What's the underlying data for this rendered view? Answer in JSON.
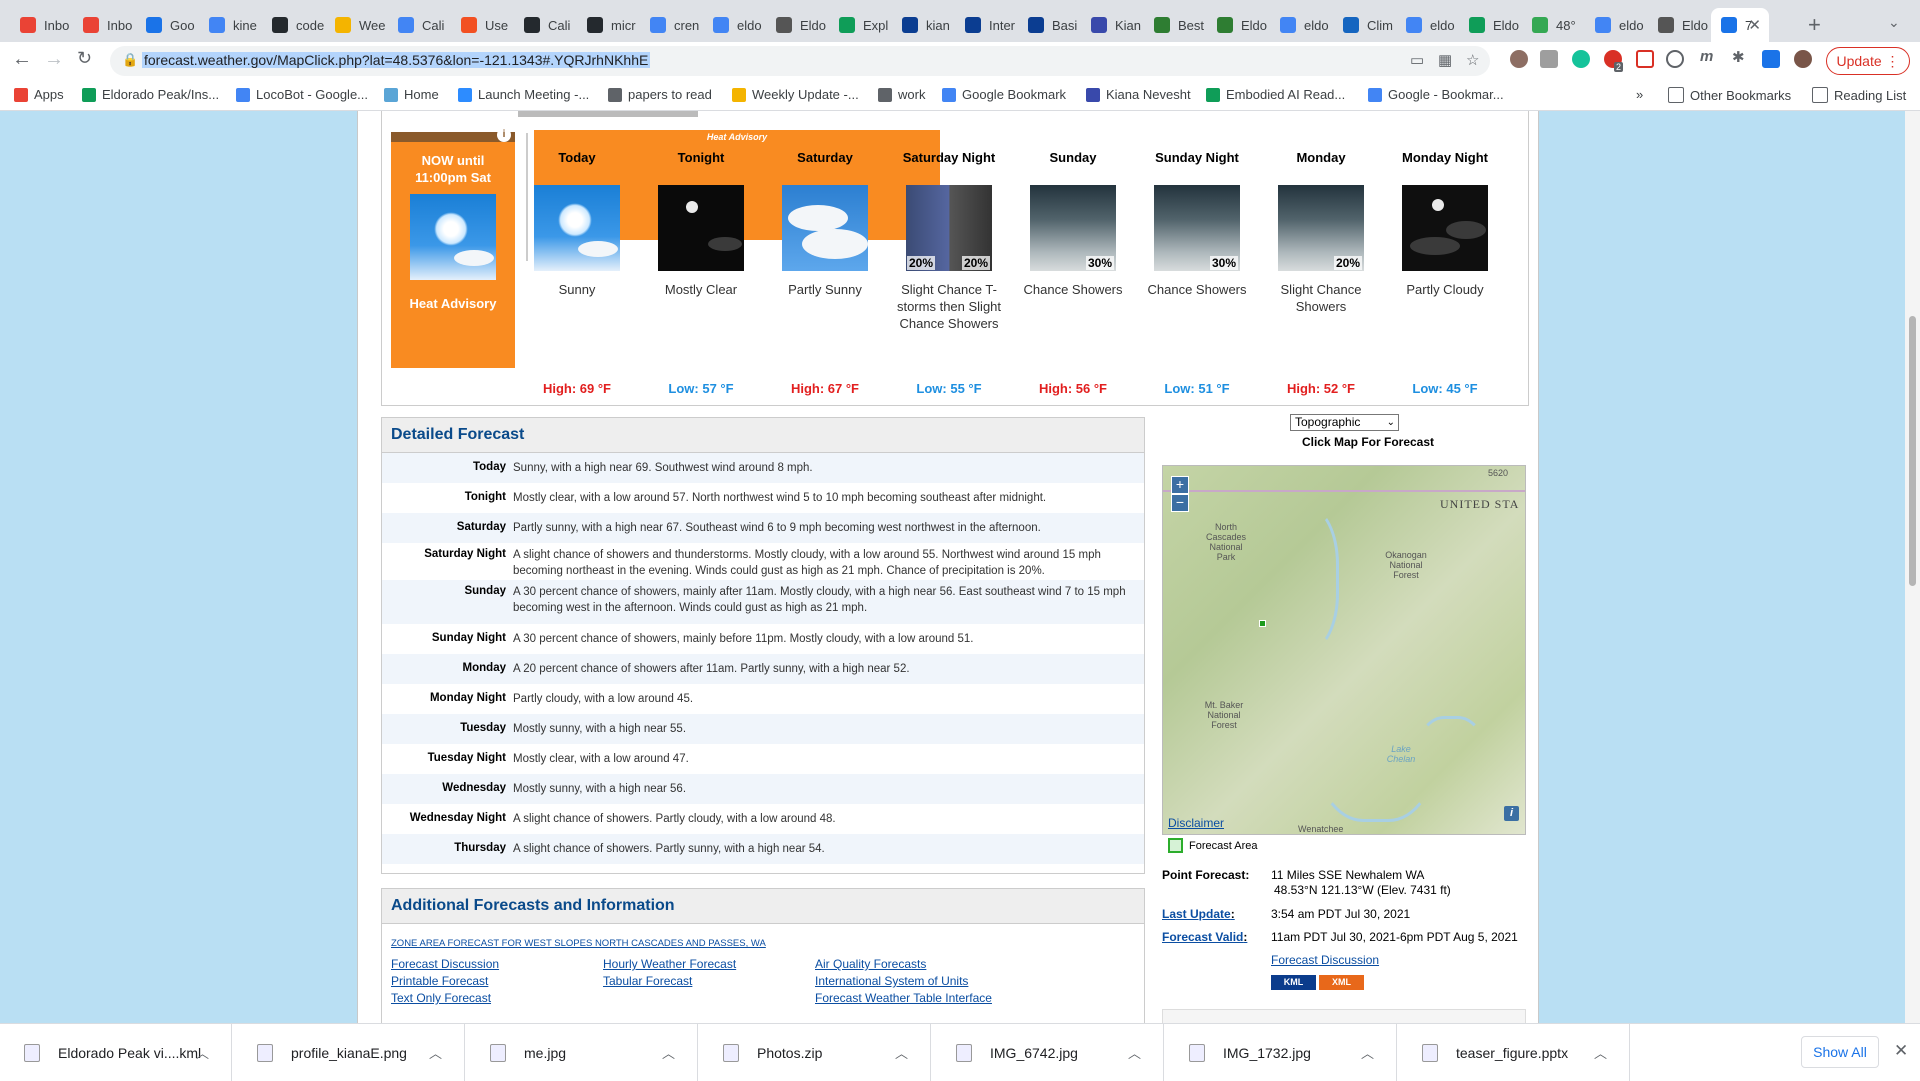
{
  "tabs": [
    {
      "title": "Inbo",
      "color": "#ea4335"
    },
    {
      "title": "Inbo",
      "color": "#ea4335"
    },
    {
      "title": "Goo",
      "color": "#1a73e8"
    },
    {
      "title": "kine",
      "color": "#4285f4"
    },
    {
      "title": "code",
      "color": "#24292e"
    },
    {
      "title": "Wee",
      "color": "#f4b400"
    },
    {
      "title": "Cali",
      "color": "#4285f4"
    },
    {
      "title": "Use",
      "color": "#f25022"
    },
    {
      "title": "Cali",
      "color": "#24292e"
    },
    {
      "title": "micr",
      "color": "#24292e"
    },
    {
      "title": "cren",
      "color": "#4285f4"
    },
    {
      "title": "eldo",
      "color": "#4285f4"
    },
    {
      "title": "Eldo",
      "color": "#555555"
    },
    {
      "title": "Expl",
      "color": "#0f9d58"
    },
    {
      "title": "kian",
      "color": "#0b3d91"
    },
    {
      "title": "Inter",
      "color": "#0b3d91"
    },
    {
      "title": "Basi",
      "color": "#0b3d91"
    },
    {
      "title": "Kian",
      "color": "#3949ab"
    },
    {
      "title": "Best",
      "color": "#2e7d32"
    },
    {
      "title": "Eldo",
      "color": "#2e7d32"
    },
    {
      "title": "eldo",
      "color": "#4285f4"
    },
    {
      "title": "Clim",
      "color": "#1565c0"
    },
    {
      "title": "eldo",
      "color": "#4285f4"
    },
    {
      "title": "Eldo",
      "color": "#0f9d58"
    },
    {
      "title": "48°",
      "color": "#34a853"
    },
    {
      "title": "eldo",
      "color": "#4285f4"
    },
    {
      "title": "Eldo",
      "color": "#555555"
    },
    {
      "title": "7",
      "color": "#1a73e8",
      "active": true
    }
  ],
  "toolbar": {
    "url": "forecast.weather.gov/MapClick.php?lat=48.5376&lon=-121.1343#.YQRJrhNKhhE",
    "update_label": "Update",
    "ext_badge": "2"
  },
  "bookmarks": [
    {
      "label": "Apps",
      "color": "#ea4335"
    },
    {
      "label": "Eldorado Peak/Ins...",
      "color": "#0f9d58"
    },
    {
      "label": "LocoBot - Google...",
      "color": "#4285f4"
    },
    {
      "label": "Home",
      "color": "#5aa5d6"
    },
    {
      "label": "Launch Meeting -...",
      "color": "#2d8cff"
    },
    {
      "label": "papers to read",
      "color": "#5f6368"
    },
    {
      "label": "Weekly Update -...",
      "color": "#f4b400"
    },
    {
      "label": "work",
      "color": "#5f6368"
    },
    {
      "label": "Google Bookmark",
      "color": "#4285f4"
    },
    {
      "label": "Kiana Nevesht",
      "color": "#3949ab"
    },
    {
      "label": "Embodied AI Read...",
      "color": "#0f9d58"
    },
    {
      "label": "Google - Bookmar...",
      "color": "#4285f4"
    }
  ],
  "bookmarks_right": {
    "more": "»",
    "other": "Other Bookmarks",
    "reading": "Reading List"
  },
  "forecast": {
    "now_label": "NOW until 11:00pm Sat",
    "now_hazard": "Heat Advisory",
    "advisory_banner": "Heat Advisory",
    "periods": [
      {
        "name": "Today",
        "desc": "Sunny",
        "temp": "High: 69 °F",
        "kind": "high",
        "img": "sunny",
        "pop": ""
      },
      {
        "name": "Tonight",
        "desc": "Mostly Clear",
        "temp": "Low: 57 °F",
        "kind": "low",
        "img": "clear",
        "pop": ""
      },
      {
        "name": "Saturday",
        "desc": "Partly Sunny",
        "temp": "High: 67 °F",
        "kind": "high",
        "img": "psunny",
        "pop": ""
      },
      {
        "name": "Saturday Night",
        "desc": "Slight Chance T-storms then Slight Chance Showers",
        "temp": "Low: 55 °F",
        "kind": "low",
        "img": "tsra",
        "pop": "20%",
        "pop2": "20%"
      },
      {
        "name": "Sunday",
        "desc": "Chance Showers",
        "temp": "High: 56 °F",
        "kind": "high",
        "img": "rain",
        "pop": "30%"
      },
      {
        "name": "Sunday Night",
        "desc": "Chance Showers",
        "temp": "Low: 51 °F",
        "kind": "low",
        "img": "rain",
        "pop": "30%"
      },
      {
        "name": "Monday",
        "desc": "Slight Chance Showers",
        "temp": "High: 52 °F",
        "kind": "high",
        "img": "rain",
        "pop": "20%"
      },
      {
        "name": "Monday Night",
        "desc": "Partly Cloudy",
        "temp": "Low: 45 °F",
        "kind": "low",
        "img": "pcloudy-n",
        "pop": ""
      }
    ],
    "high_color": "#e21f1f",
    "low_color": "#1e8fe0"
  },
  "detailed": {
    "title": "Detailed Forecast",
    "rows": [
      {
        "label": "Today",
        "text": "Sunny, with a high near 69. Southwest wind around 8 mph."
      },
      {
        "label": "Tonight",
        "text": "Mostly clear, with a low around 57. North northwest wind 5 to 10 mph becoming southeast after midnight."
      },
      {
        "label": "Saturday",
        "text": "Partly sunny, with a high near 67. Southeast wind 6 to 9 mph becoming west northwest in the afternoon."
      },
      {
        "label": "Saturday Night",
        "text": "A slight chance of showers and thunderstorms. Mostly cloudy, with a low around 55. Northwest wind around 15 mph becoming northeast in the evening. Winds could gust as high as 21 mph. Chance of precipitation is 20%."
      },
      {
        "label": "Sunday",
        "text": "A 30 percent chance of showers, mainly after 11am. Mostly cloudy, with a high near 56. East southeast wind 7 to 15 mph becoming west in the afternoon. Winds could gust as high as 21 mph."
      },
      {
        "label": "Sunday Night",
        "text": "A 30 percent chance of showers, mainly before 11pm. Mostly cloudy, with a low around 51."
      },
      {
        "label": "Monday",
        "text": "A 20 percent chance of showers after 11am. Partly sunny, with a high near 52."
      },
      {
        "label": "Monday Night",
        "text": "Partly cloudy, with a low around 45."
      },
      {
        "label": "Tuesday",
        "text": "Mostly sunny, with a high near 55."
      },
      {
        "label": "Tuesday Night",
        "text": "Mostly clear, with a low around 47."
      },
      {
        "label": "Wednesday",
        "text": "Mostly sunny, with a high near 56."
      },
      {
        "label": "Wednesday Night",
        "text": "A slight chance of showers. Partly cloudy, with a low around 48."
      },
      {
        "label": "Thursday",
        "text": "A slight chance of showers. Partly sunny, with a high near 54."
      }
    ]
  },
  "additional": {
    "title": "Additional Forecasts and Information",
    "zone_link": "ZONE AREA FORECAST FOR WEST SLOPES NORTH CASCADES AND PASSES, WA",
    "col1": [
      "Forecast Discussion",
      "Printable Forecast",
      "Text Only Forecast"
    ],
    "col2": [
      "Hourly Weather Forecast",
      "Tabular Forecast"
    ],
    "col3": [
      "Air Quality Forecasts",
      "International System of Units",
      "Forecast Weather Table Interface"
    ]
  },
  "map": {
    "select_value": "Topographic",
    "click_label": "Click Map For Forecast",
    "zoom_in": "+",
    "zoom_out": "−",
    "country_label": "UNITED STA",
    "corner_label": "5620",
    "labels": [
      "North Cascades National Park",
      "Okanogan National Forest",
      "Mt. Baker National Forest",
      "Lake Chelan",
      "Wenatchee"
    ],
    "disclaimer": "Disclaimer",
    "info": "i",
    "legend": "Forecast Area"
  },
  "point": {
    "pf_label": "Point Forecast:",
    "pf_value1": "11 Miles SSE Newhalem WA",
    "pf_value2": "48.53°N 121.13°W (Elev. 7431 ft)",
    "last_update_label": "Last Update",
    "last_update_value": "3:54 am PDT Jul 30, 2021",
    "valid_label": "Forecast Valid",
    "valid_value": "11am PDT Jul 30, 2021-6pm PDT Aug 5, 2021",
    "discussion": "Forecast Discussion",
    "kml": "KML",
    "xml": "XML"
  },
  "downloads": [
    "Eldorado Peak vi....kml",
    "profile_kianaE.png",
    "me.jpg",
    "Photos.zip",
    "IMG_6742.jpg",
    "IMG_1732.jpg",
    "teaser_figure.pptx"
  ],
  "download_bar": {
    "show_all": "Show All"
  }
}
